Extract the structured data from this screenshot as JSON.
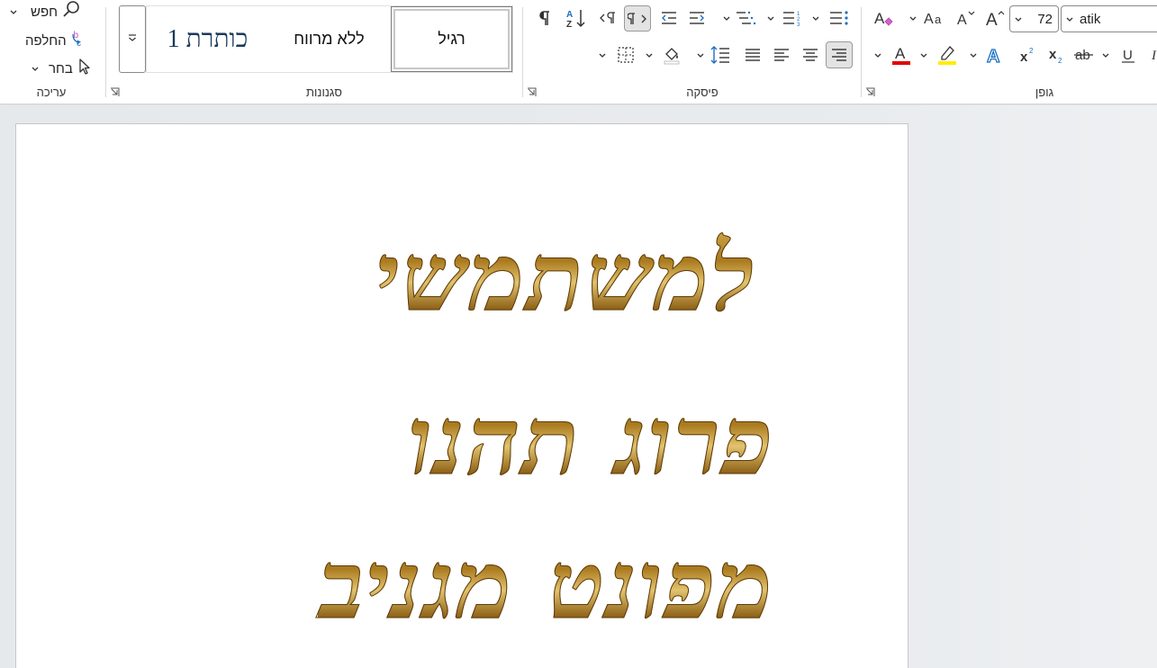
{
  "ribbon": {
    "editing": {
      "group_label": "עריכה",
      "find_label": "חפש",
      "replace_label": "החלפה",
      "select_label": "בחר"
    },
    "styles": {
      "group_label": "סגנונות",
      "items": [
        "רגיל",
        "ללא מרווח",
        "כותרת 1"
      ],
      "selected": "רגיל"
    },
    "paragraph": {
      "group_label": "פיסקה"
    },
    "font": {
      "group_label": "גופן",
      "font_name": "atik",
      "font_size": "72"
    },
    "colors": {
      "font_color": "#e00000",
      "highlight_color": "#ffee00",
      "text_effect_color": "#1b6fc2"
    }
  },
  "document": {
    "lines": [
      "למשתמשי",
      "פרוג תהנו",
      "מפונט מגניב"
    ]
  }
}
